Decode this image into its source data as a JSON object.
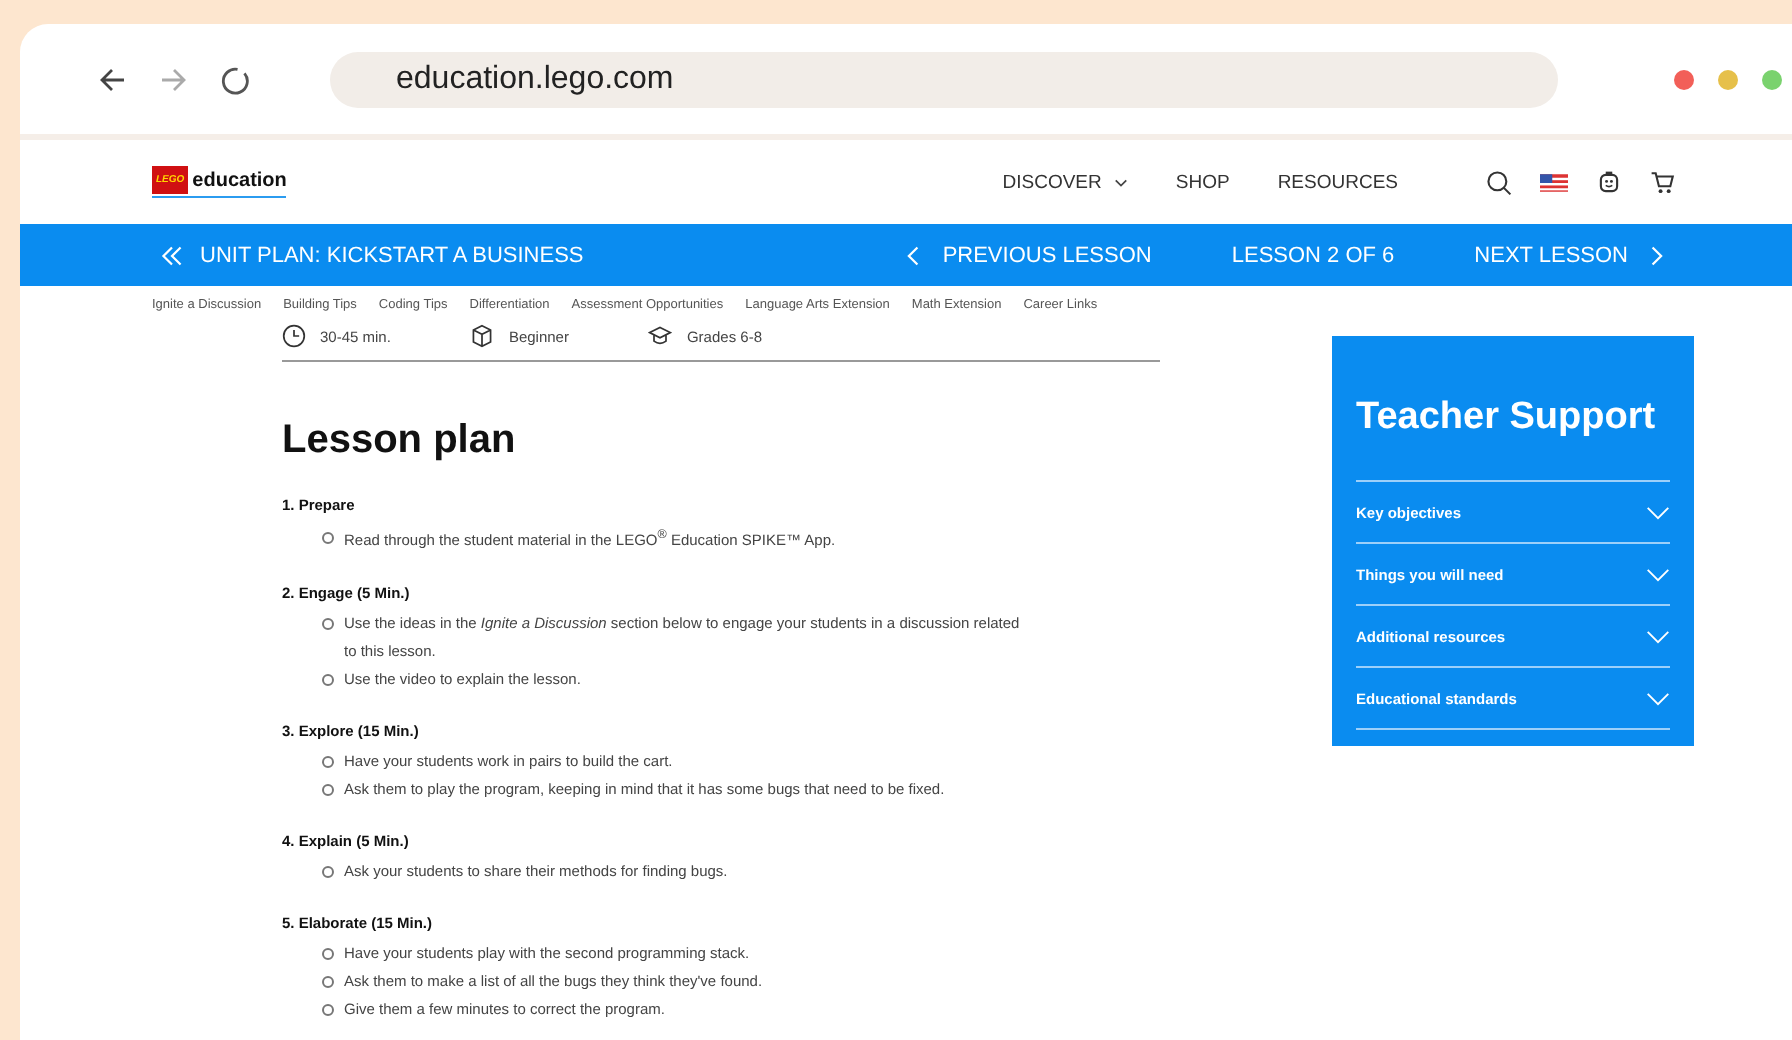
{
  "browser": {
    "url": "education.lego.com"
  },
  "header": {
    "logo_badge": "LEGO",
    "logo_text": "education",
    "nav": [
      {
        "label": "DISCOVER",
        "dropdown": true
      },
      {
        "label": "SHOP",
        "dropdown": false
      },
      {
        "label": "RESOURCES",
        "dropdown": false
      }
    ]
  },
  "unit_bar": {
    "title": "UNIT PLAN: KICKSTART A BUSINESS",
    "previous": "PREVIOUS LESSON",
    "position": "LESSON 2 OF 6",
    "next": "NEXT LESSON"
  },
  "section_links": [
    "Ignite a Discussion",
    "Building Tips",
    "Coding Tips",
    "Differentiation",
    "Assessment Opportunities",
    "Language Arts Extension",
    "Math Extension",
    "Career Links"
  ],
  "meta": [
    {
      "kind": "time",
      "text": "30-45 min."
    },
    {
      "kind": "level",
      "text": "Beginner"
    },
    {
      "kind": "grades",
      "text": "Grades 6-8"
    }
  ],
  "lesson_plan": {
    "title": "Lesson plan",
    "steps": [
      {
        "heading": "1. Prepare",
        "items": [
          "Read through the student material in the LEGO$^{®}$ Education SPIKE™ App."
        ]
      },
      {
        "heading": "2. Engage (5 Min.)",
        "items": [
          "Use the ideas in the *Ignite a Discussion* section below to engage your students in a discussion related to this lesson.",
          "Use the video to explain the lesson."
        ]
      },
      {
        "heading": "3. Explore (15 Min.)",
        "items": [
          "Have your students work in pairs to build the cart.",
          "Ask them to play the program, keeping in mind that it has some bugs that need to be fixed."
        ]
      },
      {
        "heading": "4. Explain (5 Min.)",
        "items": [
          "Ask your students to share their methods for finding bugs."
        ]
      },
      {
        "heading": "5. Elaborate (15 Min.)",
        "items": [
          "Have your students play with the second programming stack.",
          "Ask them to make a list of all the bugs they think they've found.",
          "Give them a few minutes to correct the program."
        ]
      }
    ]
  },
  "teacher_support": {
    "title": "Teacher Support",
    "sections": [
      {
        "label": "Key objectives",
        "expanded": false
      },
      {
        "label": "Things you will need",
        "expanded": false
      },
      {
        "label": "Additional resources",
        "expanded": false
      },
      {
        "label": "Educational standards",
        "expanded": false
      }
    ]
  }
}
